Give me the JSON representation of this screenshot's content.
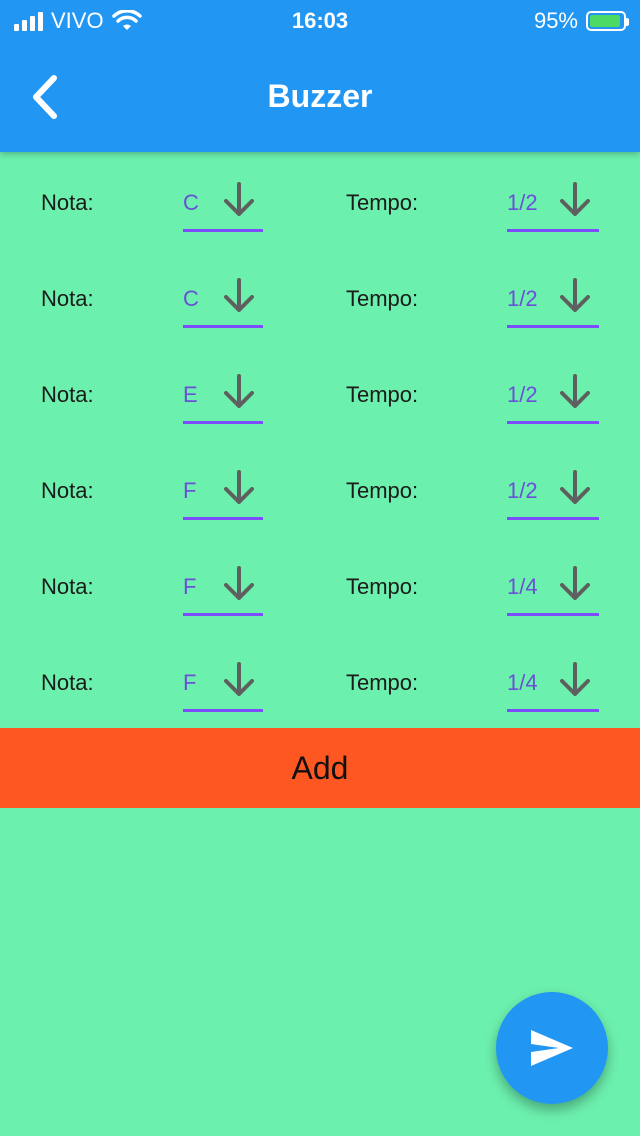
{
  "status": {
    "carrier": "VIVO",
    "time": "16:03",
    "battery": "95%",
    "battery_level": 0.95
  },
  "appbar": {
    "title": "Buzzer",
    "back_icon": "chevron-left-icon"
  },
  "rows": [
    {
      "nota_label": "Nota:",
      "nota": "C",
      "tempo_label": "Tempo:",
      "tempo": "1/2"
    },
    {
      "nota_label": "Nota:",
      "nota": "C",
      "tempo_label": "Tempo:",
      "tempo": "1/2"
    },
    {
      "nota_label": "Nota:",
      "nota": "E",
      "tempo_label": "Tempo:",
      "tempo": "1/2"
    },
    {
      "nota_label": "Nota:",
      "nota": "F",
      "tempo_label": "Tempo:",
      "tempo": "1/2"
    },
    {
      "nota_label": "Nota:",
      "nota": "F",
      "tempo_label": "Tempo:",
      "tempo": "1/4"
    },
    {
      "nota_label": "Nota:",
      "nota": "F",
      "tempo_label": "Tempo:",
      "tempo": "1/4"
    }
  ],
  "add_button": {
    "label": "Add"
  },
  "fab": {
    "icon": "send-icon"
  },
  "colors": {
    "appbar": "#2196f3",
    "background": "#6cf0ae",
    "add_button": "#ff5722",
    "dropdown_underline": "#7c4dff",
    "fab": "#2196f3"
  }
}
